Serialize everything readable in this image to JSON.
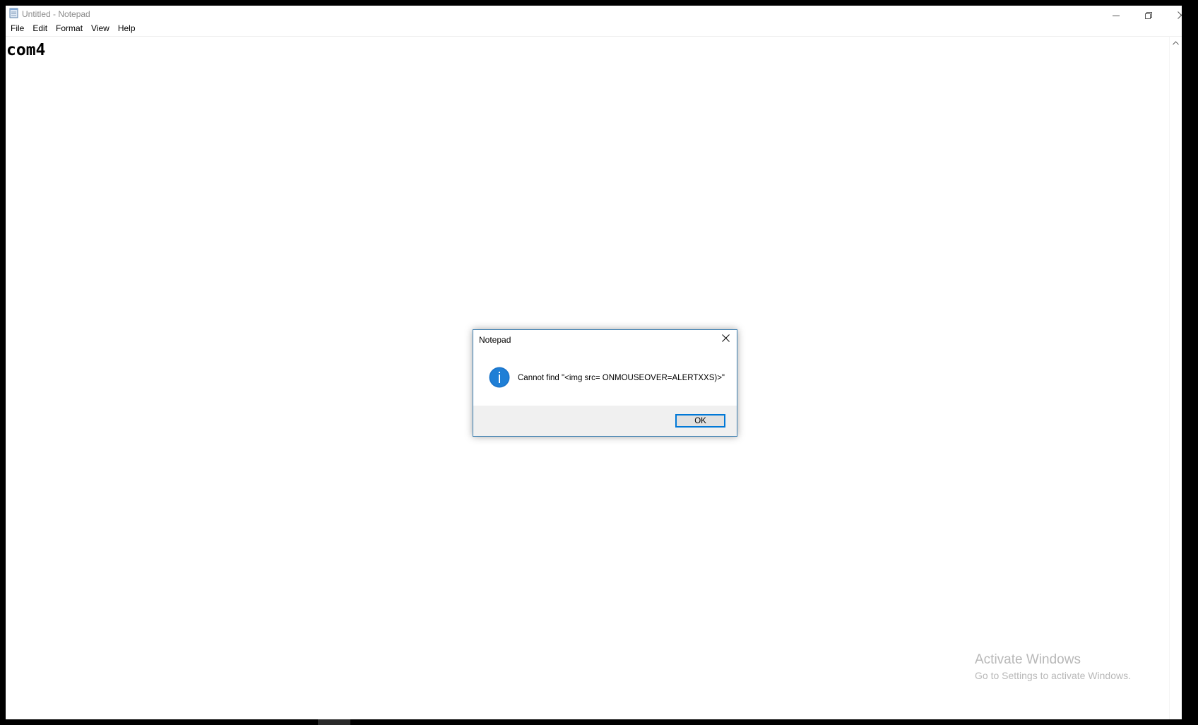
{
  "window": {
    "title": "Untitled - Notepad",
    "controls": {
      "minimize_icon": "minimize-icon",
      "restore_icon": "restore-icon",
      "close_icon": "close-icon"
    }
  },
  "menu": {
    "items": [
      {
        "label": "File"
      },
      {
        "label": "Edit"
      },
      {
        "label": "Format"
      },
      {
        "label": "View"
      },
      {
        "label": "Help"
      }
    ]
  },
  "editor": {
    "content": "com4"
  },
  "dialog": {
    "title": "Notepad",
    "message": "Cannot find \"<img src= ONMOUSEOVER=ALERTXXS)>\"",
    "icon": "info-icon",
    "ok_label": "OK",
    "accent_color": "#0078d7"
  },
  "watermark": {
    "title": "Activate Windows",
    "subtitle": "Go to Settings to activate Windows."
  }
}
